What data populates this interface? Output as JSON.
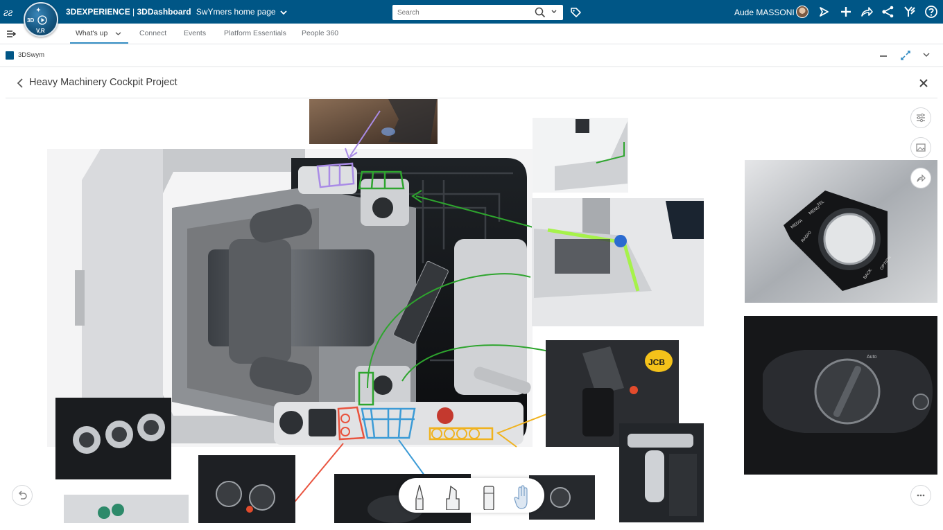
{
  "header": {
    "brand": "3DEXPERIENCE",
    "separator": " | ",
    "app": "3DDashboard",
    "dashboard": "SwYmers home page",
    "compass": {
      "top": "3D",
      "bottom": "V,R"
    },
    "search_placeholder": "Search",
    "user_name": "Aude MASSONI"
  },
  "nav": {
    "tabs": [
      {
        "label": "What's up"
      },
      {
        "label": "Connect"
      },
      {
        "label": "Events"
      },
      {
        "label": "Platform Essentials"
      },
      {
        "label": "People 360"
      }
    ]
  },
  "widget": {
    "name": "3DSwym"
  },
  "project": {
    "title": "Heavy Machinery Cockpit Project"
  },
  "canvas": {
    "board_labels": {
      "jcb": "JCB",
      "auto": "Auto",
      "media": "MEDIA",
      "menu": "MENU",
      "tel": "TEL",
      "back": "BACK",
      "option": "OPTION",
      "radio": "RADIO"
    }
  },
  "colors": {
    "header_bg": "#005686",
    "tab_accent": "#368ec4",
    "annotation_purple": "#a98be6",
    "annotation_green": "#2ea52e",
    "annotation_orange": "#f0b21e",
    "annotation_red": "#e9533e",
    "annotation_blue": "#3c9bd6"
  },
  "icons": [
    "ds-logo-icon",
    "compass-icon",
    "chevron-down-icon",
    "search-icon",
    "tag-icon",
    "avatar",
    "share-icon",
    "plus-icon",
    "forward-icon",
    "network-icon",
    "swym-icon",
    "help-icon",
    "menu-toggle-icon",
    "back-chevron-icon",
    "close-icon",
    "minimize-icon",
    "expand-icon",
    "filter-icon",
    "image-icon",
    "undo-icon",
    "more-icon",
    "pen-icon",
    "marker-icon",
    "eraser-icon",
    "hand-icon"
  ]
}
